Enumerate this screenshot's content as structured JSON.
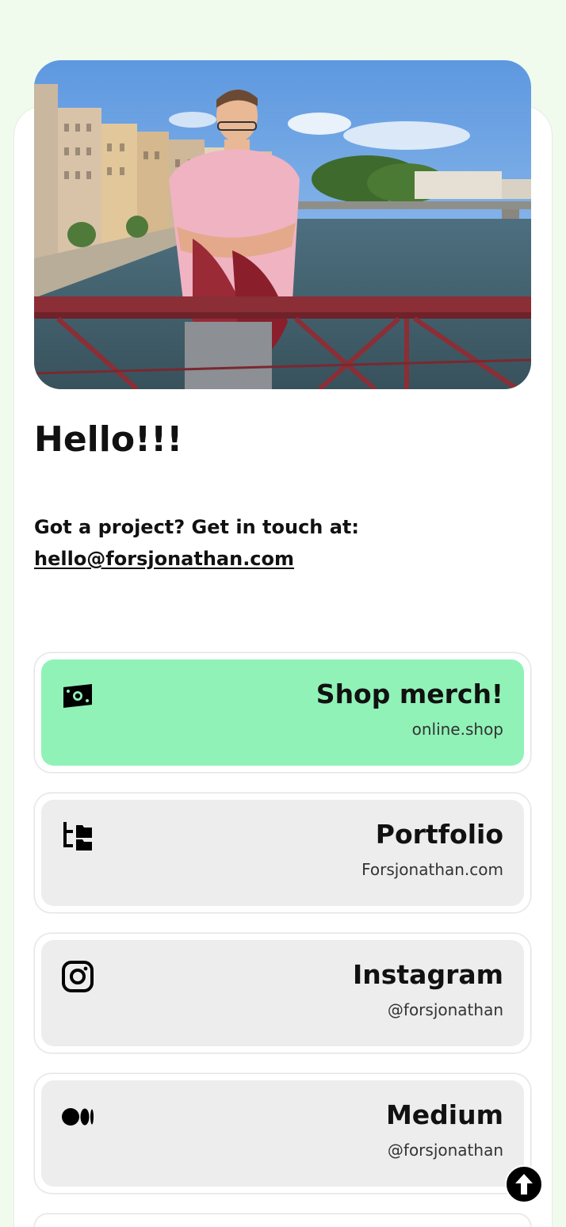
{
  "profile": {
    "photo_icon": "profile-photo",
    "greeting": "Hello!!!",
    "contact_prompt": "Got a project? Get in touch at:",
    "email": "hello@forsjonathan.com"
  },
  "links": [
    {
      "title": "Shop merch!",
      "subtitle": "online.shop",
      "icon": "money-icon",
      "accent": "#90f2b7"
    },
    {
      "title": "Portfolio",
      "subtitle": "Forsjonathan.com",
      "icon": "folder-tree-icon"
    },
    {
      "title": "Instagram",
      "subtitle": "@forsjonathan",
      "icon": "instagram-icon"
    },
    {
      "title": "Medium",
      "subtitle": "@forsjonathan",
      "icon": "medium-icon"
    }
  ],
  "colors": {
    "page_background": "#f0fbee",
    "card_background": "#ffffff",
    "link_background": "#ededed",
    "link_accent": "#90f2b7"
  },
  "scroll_top_icon": "arrow-up-icon"
}
